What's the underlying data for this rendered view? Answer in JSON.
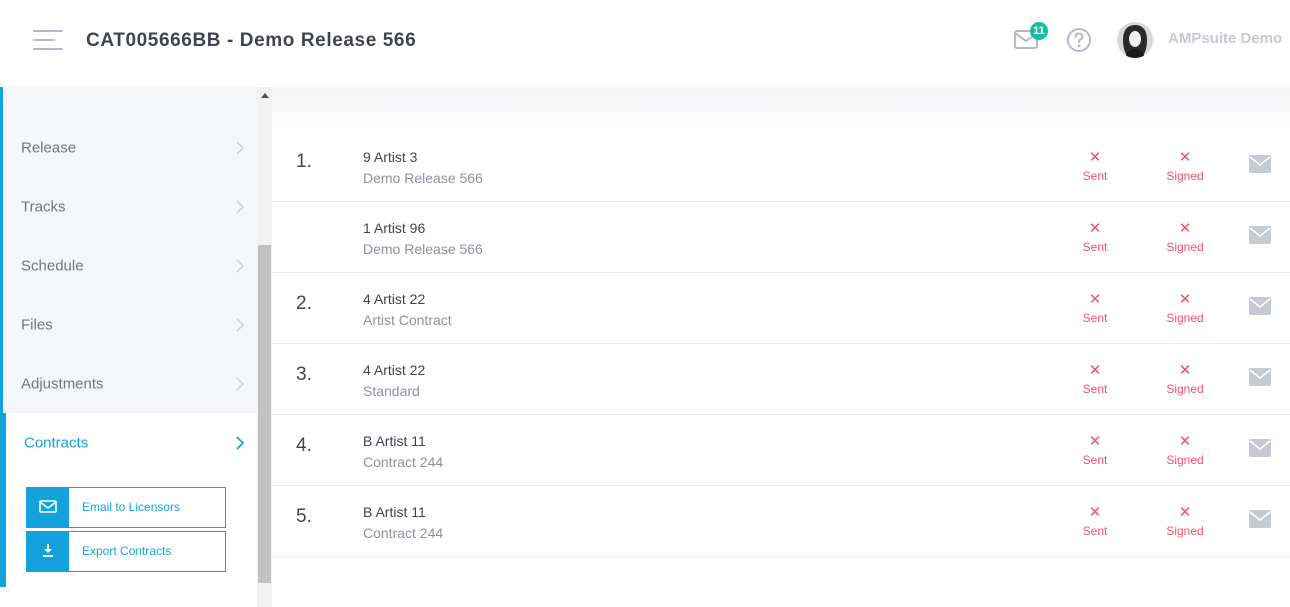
{
  "header": {
    "title": "CAT005666BB - Demo Release 566",
    "mail_count": "11",
    "user_name": "AMPsuite Demo",
    "icons": {
      "menu": "hamburger-icon",
      "mail": "envelope-icon",
      "help": "question-circle-icon",
      "avatar": "user-avatar"
    }
  },
  "sidebar": {
    "items": [
      {
        "label": "Release"
      },
      {
        "label": "Tracks"
      },
      {
        "label": "Schedule"
      },
      {
        "label": "Files"
      },
      {
        "label": "Adjustments"
      },
      {
        "label": "Contracts",
        "active": true
      }
    ],
    "actions": [
      {
        "label": "Email to Licensors",
        "icon": "envelope-icon"
      },
      {
        "label": "Export Contracts",
        "icon": "download-icon"
      }
    ]
  },
  "contracts": {
    "status_labels": {
      "sent": "Sent",
      "signed": "Signed"
    },
    "rows": [
      {
        "num": "1.",
        "name": "9 Artist 3",
        "sub": "Demo Release 566",
        "sent": false,
        "signed": false
      },
      {
        "num": "",
        "name": "1 Artist 96",
        "sub": "Demo Release 566",
        "sent": false,
        "signed": false
      },
      {
        "num": "2.",
        "name": "4 Artist 22",
        "sub": "Artist Contract",
        "sent": false,
        "signed": false
      },
      {
        "num": "3.",
        "name": "4 Artist 22",
        "sub": "Standard",
        "sent": false,
        "signed": false
      },
      {
        "num": "4.",
        "name": "B Artist 11",
        "sub": "Contract 244",
        "sent": false,
        "signed": false
      },
      {
        "num": "5.",
        "name": "B Artist 11",
        "sub": "Contract 244",
        "sent": false,
        "signed": false
      }
    ]
  },
  "colors": {
    "accent": "#14a2df",
    "error": "#f4516c",
    "badge": "#1bbc9b"
  }
}
